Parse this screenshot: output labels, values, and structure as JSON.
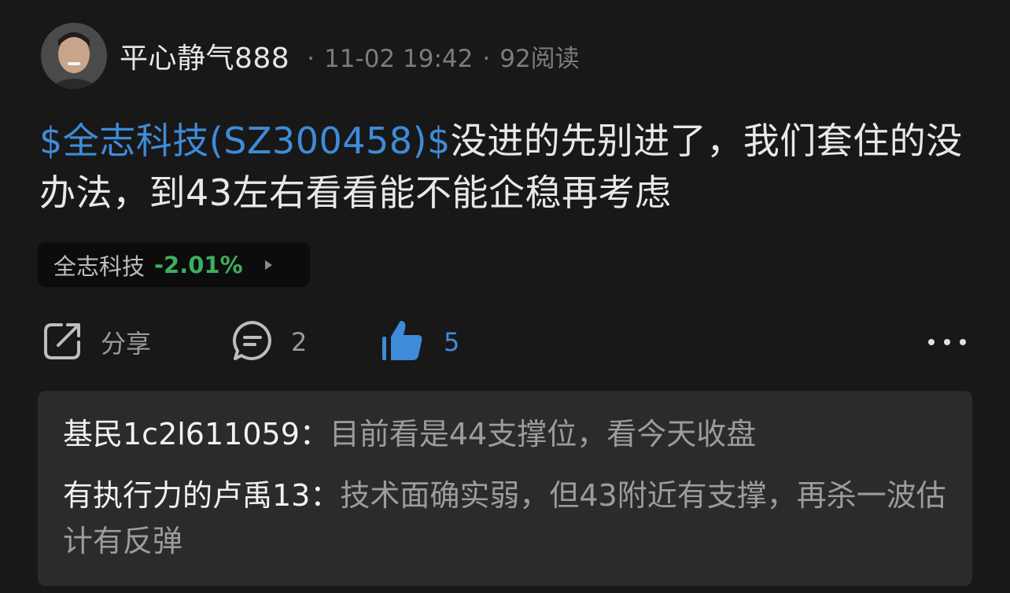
{
  "post": {
    "author": "平心静气888",
    "dot": "·",
    "date": "11-02 19:42",
    "reads": "92阅读",
    "stock_link": "$全志科技(SZ300458)$",
    "content": "没进的先别进了，我们套住的没办法，到43左右看看能不能企稳再考虑"
  },
  "stock_chip": {
    "name": "全志科技",
    "change": "-2.01%"
  },
  "actions": {
    "share_label": "分享",
    "comment_count": "2",
    "like_count": "5"
  },
  "comments": [
    {
      "author": "基民1c2l611059：",
      "text": "目前看是44支撑位，看今天收盘"
    },
    {
      "author": "有执行力的卢禹13：",
      "text": "技术面确实弱，但43附近有支撑，再杀一波估计有反弹"
    }
  ],
  "colors": {
    "background": "#181818",
    "link": "#3f8bd8",
    "down_green": "#3cae5f",
    "comment_bg": "#2b2b2d"
  },
  "icons": {
    "share": "share-icon",
    "comment": "comment-icon",
    "like": "thumbs-up-icon",
    "more": "more-icon"
  }
}
